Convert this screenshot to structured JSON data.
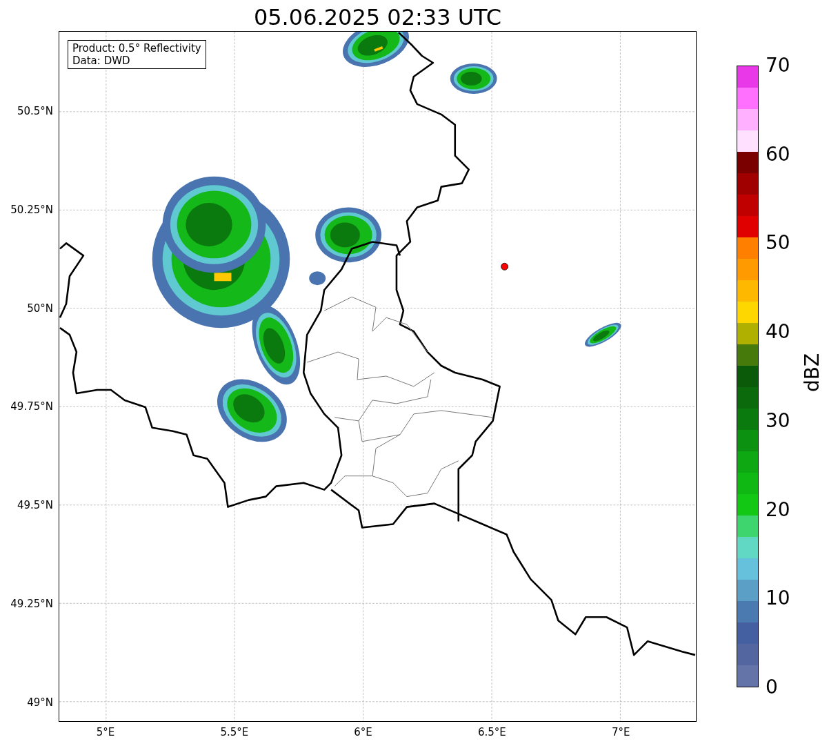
{
  "title": "05.06.2025 02:33 UTC",
  "legend": [
    "Product: 0.5° Reflectivity",
    "Data: DWD"
  ],
  "map": {
    "x_ticks": [
      "5°E",
      "5.5°E",
      "6°E",
      "6.5°E",
      "7°E"
    ],
    "y_ticks": [
      "50.5°N",
      "50.25°N",
      "50°N",
      "49.75°N",
      "49.5°N",
      "49.25°N",
      "49°N"
    ]
  },
  "colorbar": {
    "label": "dBZ",
    "ticks": [
      "70",
      "60",
      "50",
      "40",
      "30",
      "20",
      "10",
      "0"
    ],
    "steps": [
      {
        "color": "#e838e8"
      },
      {
        "color": "#ff70ff"
      },
      {
        "color": "#ffb0ff"
      },
      {
        "color": "#ffe0ff"
      },
      {
        "color": "#7a0000"
      },
      {
        "color": "#a00000"
      },
      {
        "color": "#c00000"
      },
      {
        "color": "#e00000"
      },
      {
        "color": "#ff7f00"
      },
      {
        "color": "#ff9a00"
      },
      {
        "color": "#ffb800"
      },
      {
        "color": "#ffd700"
      },
      {
        "color": "#b0b000"
      },
      {
        "color": "#467a0a"
      },
      {
        "color": "#0a5a0a"
      },
      {
        "color": "#0a6a0c"
      },
      {
        "color": "#0a7a0e"
      },
      {
        "color": "#0c9210"
      },
      {
        "color": "#0ea812"
      },
      {
        "color": "#10b814"
      },
      {
        "color": "#12c814"
      },
      {
        "color": "#3ed46e"
      },
      {
        "color": "#60d8c4"
      },
      {
        "color": "#66c2dc"
      },
      {
        "color": "#5b9ec6"
      },
      {
        "color": "#4a7ab0"
      },
      {
        "color": "#4460a0"
      },
      {
        "color": "#5366a0"
      },
      {
        "color": "#6574a8"
      }
    ]
  }
}
